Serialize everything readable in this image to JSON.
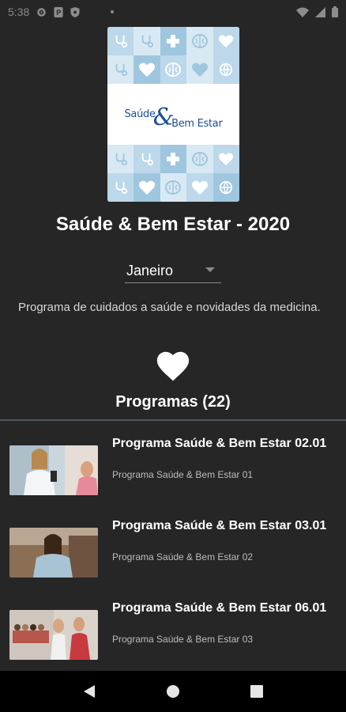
{
  "status_bar": {
    "time": "5:38"
  },
  "cover": {
    "logo_line1": "Saúde",
    "logo_amp": "&",
    "logo_line2": "Bem Estar"
  },
  "page_title": "Saúde & Bem Estar - 2020",
  "month_select": {
    "selected": "Janeiro"
  },
  "description": "Programa de cuidados a saúde e novidades da medicina.",
  "programs_heading": "Programas (22)",
  "episodes": [
    {
      "title": "Programa Saúde & Bem Estar 02.01",
      "subtitle": "Programa Saúde & Bem Estar 01"
    },
    {
      "title": "Programa Saúde & Bem Estar 03.01",
      "subtitle": "Programa Saúde & Bem Estar 02"
    },
    {
      "title": "Programa Saúde & Bem Estar 06.01",
      "subtitle": "Programa Saúde & Bem Estar 03"
    }
  ],
  "icons": {
    "status_left": [
      "gear-icon",
      "p-badge-icon",
      "shield-icon",
      "dot-icon"
    ],
    "status_right": [
      "wifi-icon",
      "signal-icon",
      "battery-icon"
    ],
    "nav": [
      "back-icon",
      "home-icon",
      "recents-icon"
    ]
  },
  "colors": {
    "background": "#262626",
    "divider": "#4c5a63",
    "logo_blue": "#1d4f96",
    "nav_bar": "#000000"
  }
}
